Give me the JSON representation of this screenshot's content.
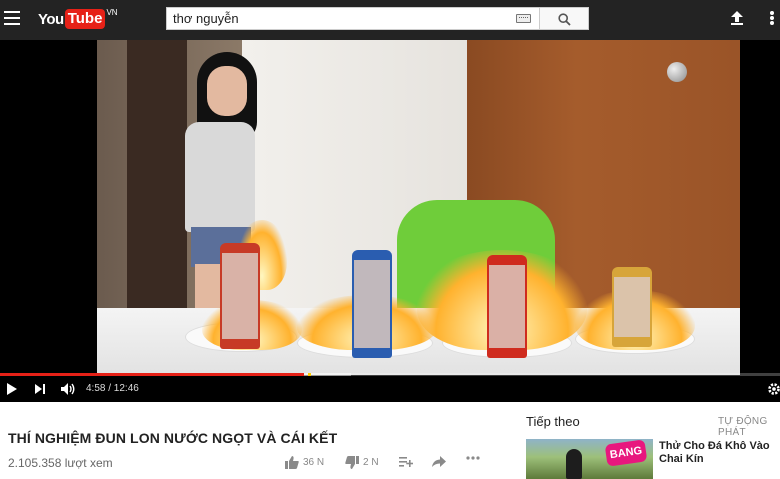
{
  "header": {
    "logo_you": "You",
    "logo_tube": "Tube",
    "logo_region": "VN",
    "search_value": "thơ nguyễn",
    "icons": [
      "menu-icon",
      "keyboard-icon",
      "search-icon",
      "upload-icon",
      "more-vertical-icon"
    ]
  },
  "player": {
    "current_time": "4:58",
    "duration": "12:46",
    "time_display": "4:58 / 12:46",
    "progress_fraction": 0.39,
    "buffer_fraction": 0.45,
    "icons": [
      "play-icon",
      "next-icon",
      "volume-icon",
      "settings-icon"
    ],
    "colors": {
      "progress": "#e62117",
      "ad_marker": "#ffcc00"
    }
  },
  "video": {
    "title": "THÍ NGHIỆM ĐUN LON NƯỚC NGỌT VÀ CÁI KẾT",
    "views": "2.105.358 lượt xem",
    "likes": "36 N",
    "dislikes": "2 N"
  },
  "sidebar": {
    "up_next_label": "Tiếp theo",
    "autoplay_label": "TỰ ĐỘNG PHÁT",
    "recommended": [
      {
        "title": "Thử Cho Đá Khô Vào Chai Kín",
        "thumbnail_text": "BANG"
      }
    ]
  }
}
